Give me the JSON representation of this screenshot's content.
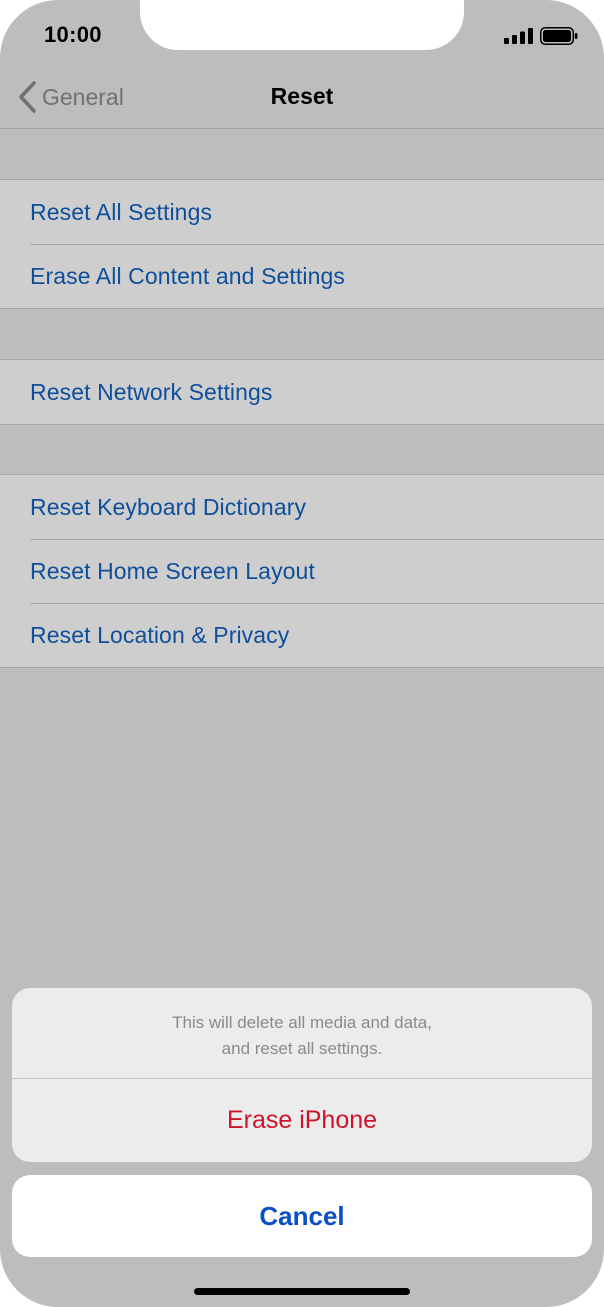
{
  "status_bar": {
    "time": "10:00",
    "signal_icon": "cellular-signal-icon",
    "battery_icon": "battery-icon"
  },
  "nav": {
    "back_label": "General",
    "back_icon": "chevron-left-icon",
    "title": "Reset"
  },
  "groups": [
    {
      "rows": [
        {
          "label": "Reset All Settings"
        },
        {
          "label": "Erase All Content and Settings"
        }
      ]
    },
    {
      "rows": [
        {
          "label": "Reset Network Settings"
        }
      ]
    },
    {
      "rows": [
        {
          "label": "Reset Keyboard Dictionary"
        },
        {
          "label": "Reset Home Screen Layout"
        },
        {
          "label": "Reset Location & Privacy"
        }
      ]
    }
  ],
  "action_sheet": {
    "message_line1": "This will delete all media and data,",
    "message_line2": "and reset all settings.",
    "destructive_label": "Erase iPhone",
    "cancel_label": "Cancel"
  },
  "colors": {
    "link_blue": "#0e4e9b",
    "destructive_red": "#d0132c",
    "cancel_blue": "#0a50c4",
    "dimmed_background": "#bdbdbf"
  }
}
